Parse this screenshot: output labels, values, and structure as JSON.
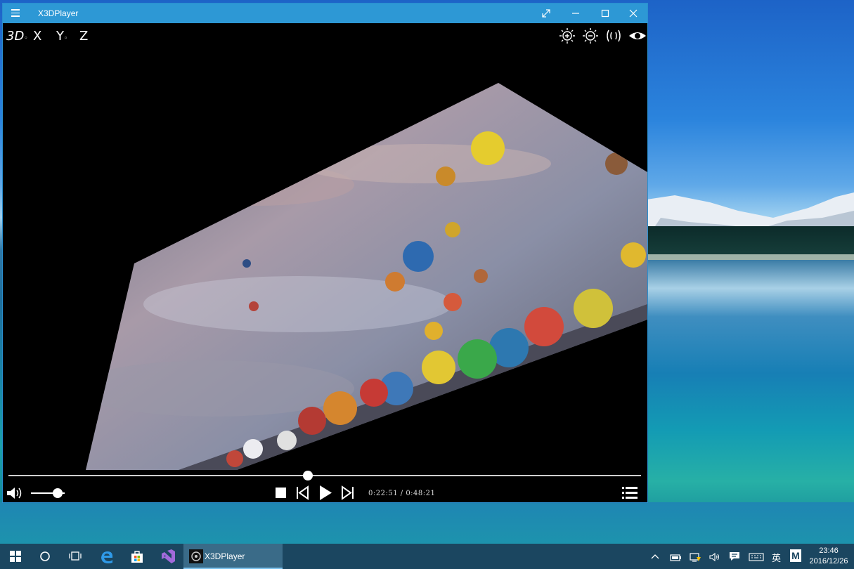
{
  "window": {
    "title": "X3DPlayer"
  },
  "top_controls": {
    "mode_3d": "3D",
    "axis_x": "X",
    "axis_y": "Y",
    "axis_z": "Z",
    "subscript": "◦"
  },
  "playback": {
    "current_time": "0:22:51",
    "separator": "/",
    "total_time": "0:48:21",
    "progress_fraction": 0.473,
    "volume_fraction": 0.8
  },
  "taskbar": {
    "running_app_label": "X3DPlayer",
    "ime_label": "英",
    "ime_mode": "M",
    "clock_time": "23:46",
    "clock_date": "2016/12/26"
  },
  "colors": {
    "titlebar": "#2d98d5",
    "taskbar": "#1b4660",
    "accent": "#7cc2ec"
  },
  "icons": {
    "menu": "hamburger-icon",
    "fullscreen": "expand-icon",
    "minimize": "minimize-icon",
    "maximize": "maximize-icon",
    "close": "close-icon",
    "brightness_up": "brightness-plus-icon",
    "brightness_down": "brightness-minus-icon",
    "audio_3d": "surround-icon",
    "view": "eye-icon",
    "volume": "speaker-icon",
    "stop": "stop-icon",
    "prev": "previous-icon",
    "play": "play-icon",
    "next": "next-icon",
    "playlist": "playlist-icon"
  }
}
